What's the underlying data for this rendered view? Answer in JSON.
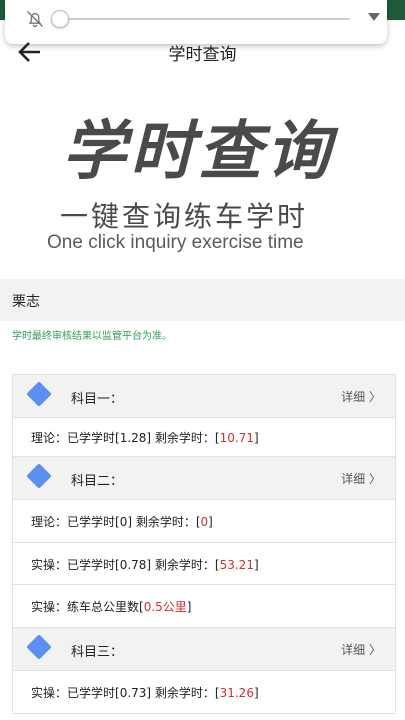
{
  "header": {
    "title": "学时查询"
  },
  "hero": {
    "title": "学时查询",
    "subtitle": "一键查询练车学时",
    "english": "One click inquiry exercise time"
  },
  "volume_panel": {
    "level": 0.0
  },
  "student": {
    "name": "栗志"
  },
  "notice": "学时最终审核结果以监管平台为准。",
  "subjects": [
    {
      "name": "科目一：",
      "detail_label": "详细 〉",
      "rows": [
        {
          "prefix": "理论：已学学时[",
          "a": "1.28",
          "mid": "] 剩余学时：[",
          "b": "10.71",
          "suffix": "]"
        }
      ]
    },
    {
      "name": "科目二：",
      "detail_label": "详细 〉",
      "rows": [
        {
          "prefix": "理论：已学学时[",
          "a": "0",
          "mid": "] 剩余学时：[",
          "b": "0",
          "suffix": "]"
        },
        {
          "prefix": "实操：已学学时[",
          "a": "0.78",
          "mid": "] 剩余学时：[",
          "b": "53.21",
          "suffix": "]"
        }
      ],
      "mileage": {
        "prefix": "实操：练车总公里数[",
        "value": "0.5公里",
        "suffix": "]"
      }
    },
    {
      "name": "科目三：",
      "detail_label": "详细 〉",
      "rows": [
        {
          "prefix": "实操：已学学时[",
          "a": "0.73",
          "mid": "] 剩余学时：[",
          "b": "31.26",
          "suffix": "]"
        }
      ]
    }
  ],
  "colors": {
    "accent_green": "#2e9b5a",
    "value_red": "#d32f2f",
    "diamond_blue": "#5b8ff2"
  }
}
